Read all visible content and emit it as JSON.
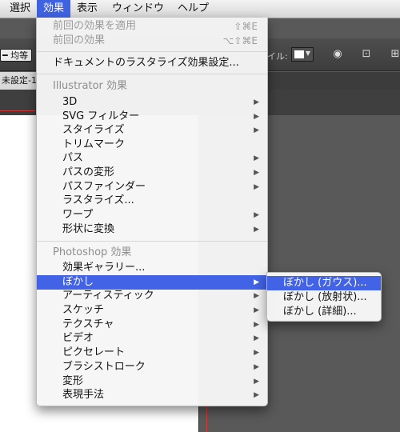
{
  "menubar": {
    "items": [
      "選択",
      "効果",
      "表示",
      "ウィンドウ",
      "ヘルプ"
    ],
    "active_index": 1
  },
  "controlbar": {
    "stroke_value": "━ 均等",
    "style_label": "イル:",
    "icons": [
      "recolor-icon",
      "align-grid-icon",
      "grid-icon"
    ]
  },
  "document_tab": {
    "label": "未設定-1"
  },
  "effect_menu": {
    "apply_last": "前回の効果を適用",
    "apply_last_shortcut": "⇧⌘E",
    "last_effect": "前回の効果",
    "last_effect_shortcut": "⌥⇧⌘E",
    "raster_settings": "ドキュメントのラスタライズ効果設定...",
    "illustrator_header": "Illustrator 効果",
    "illustrator_items": [
      "3D",
      "SVG フィルター",
      "スタイライズ",
      "トリムマーク",
      "パス",
      "パスの変形",
      "パスファインダー",
      "ラスタライズ...",
      "ワープ",
      "形状に変換"
    ],
    "photoshop_header": "Photoshop 効果",
    "photoshop_items": [
      "効果ギャラリー...",
      "ぼかし",
      "アーティスティック",
      "スケッチ",
      "テクスチャ",
      "ビデオ",
      "ピクセレート",
      "ブラシストローク",
      "変形",
      "表現手法"
    ]
  },
  "blur_submenu": {
    "items": [
      "ぼかし (ガウス)...",
      "ぼかし (放射状)...",
      "ぼかし (詳細)..."
    ]
  },
  "colors": {
    "selection": "#4263e6",
    "menu_bg": "#f6f6f6",
    "canvas_bg": "#595959",
    "guide_red": "#d23a3a"
  }
}
